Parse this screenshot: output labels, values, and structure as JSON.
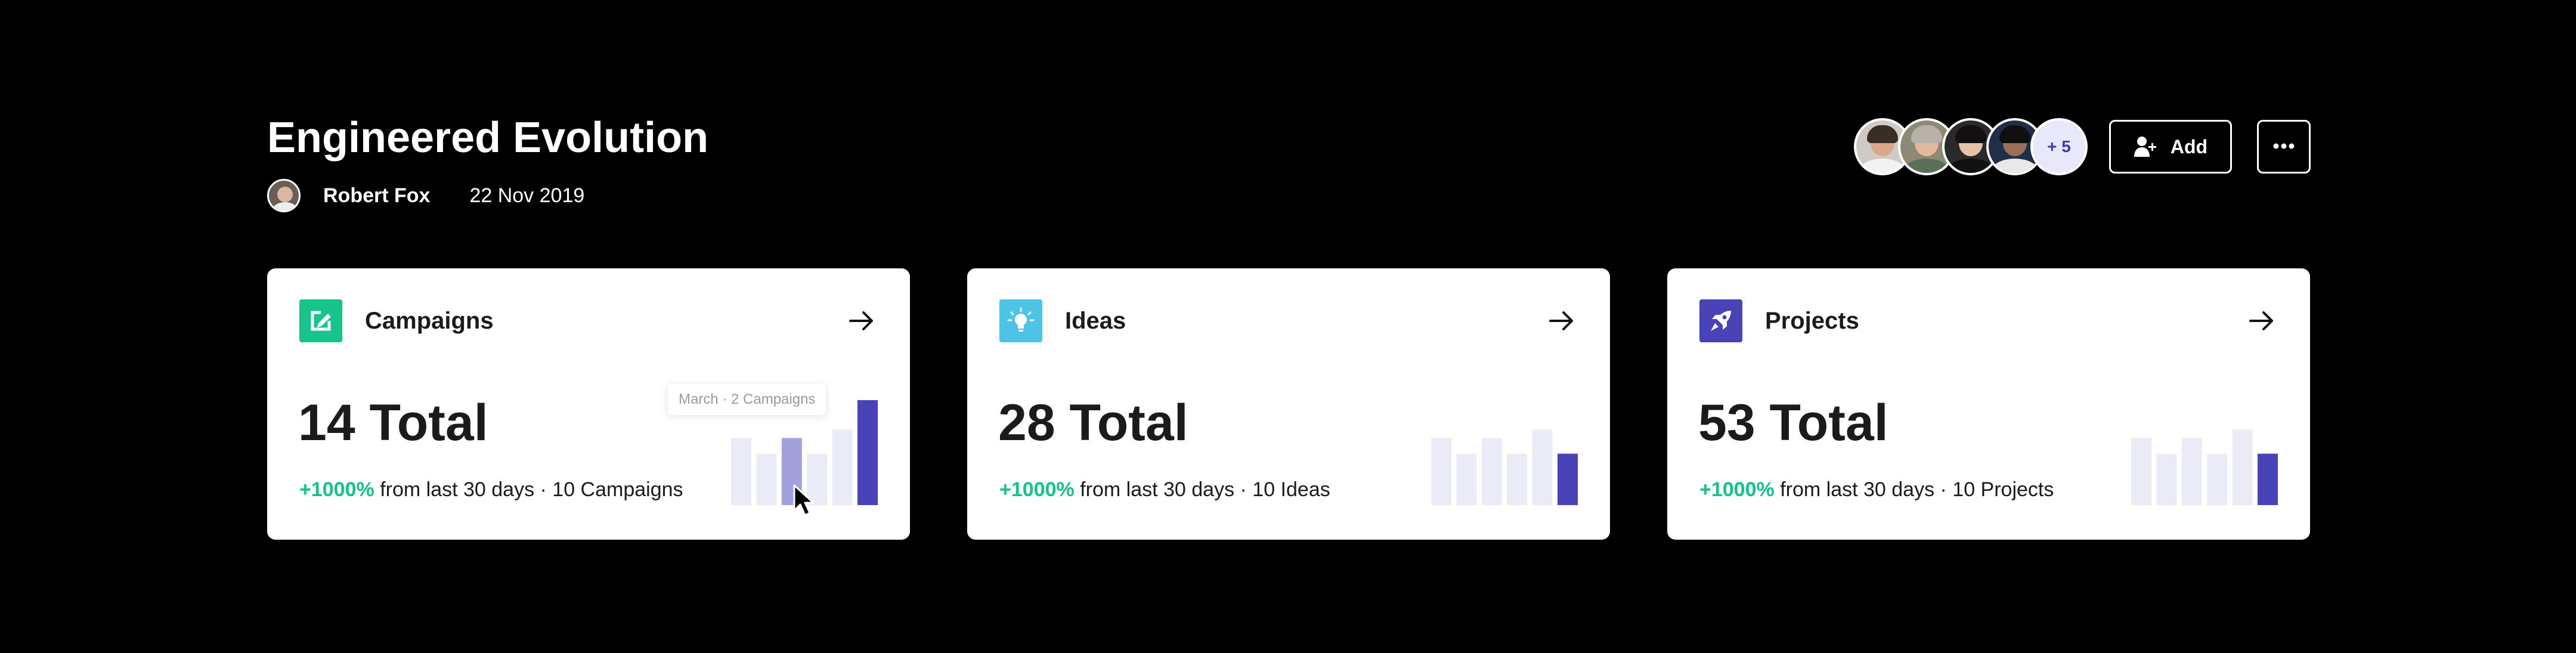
{
  "header": {
    "title": "Engineered Evolution",
    "author": "Robert Fox",
    "date": "22 Nov 2019"
  },
  "team": {
    "more_count": "+ 5",
    "add_label": "Add"
  },
  "cards": [
    {
      "title": "Campaigns",
      "total": "14 Total",
      "change": "+1000%",
      "detail": "from last 30 days · 10 Campaigns",
      "icon": "edit-square-icon",
      "icon_color": "#17c58c",
      "tooltip": "March · 2 Campaigns",
      "bars": [
        0.64,
        0.49,
        0.64,
        0.49,
        0.72,
        1.0
      ],
      "highlight_index": 2
    },
    {
      "title": "Ideas",
      "total": "28 Total",
      "change": "+1000%",
      "detail": "from last 30 days · 10 Ideas",
      "icon": "lightbulb-icon",
      "icon_color": "#4dc3e6",
      "bars": [
        0.64,
        0.49,
        0.64,
        0.49,
        0.72,
        0.49
      ],
      "highlight_index": -1
    },
    {
      "title": "Projects",
      "total": "53 Total",
      "change": "+1000%",
      "detail": "from last 30 days · 10 Projects",
      "icon": "rocket-icon",
      "icon_color": "#4844b8",
      "bars": [
        0.64,
        0.49,
        0.64,
        0.49,
        0.72,
        0.49
      ],
      "highlight_index": -1
    }
  ],
  "colors": {
    "bar_muted": "#ebebf7",
    "bar_hover": "#a3a1dd",
    "bar_active": "#4844b8",
    "positive": "#10c48a"
  }
}
